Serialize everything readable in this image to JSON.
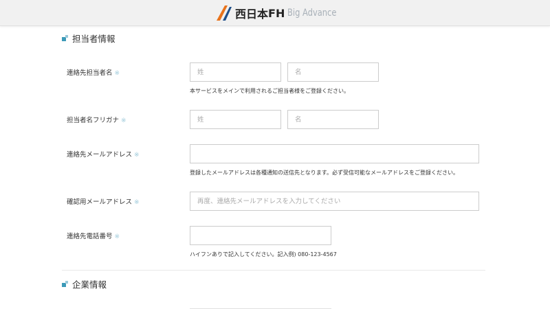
{
  "header": {
    "logo_jp": "西日本",
    "logo_fh": "FH",
    "logo_en": "Big Advance"
  },
  "section_contact": {
    "title": "担当者情報"
  },
  "section_company": {
    "title": "企業情報"
  },
  "required_mark": "※",
  "form": {
    "contact_name": {
      "label": "連絡先担当者名",
      "last_placeholder": "姓",
      "first_placeholder": "名",
      "help": "本サービスをメインで利用されるご担当者様をご登録ください。"
    },
    "contact_kana": {
      "label": "担当者名フリガナ",
      "last_placeholder": "姓",
      "first_placeholder": "名"
    },
    "email": {
      "label": "連絡先メールアドレス",
      "value": "",
      "help": "登録したメールアドレスは各種通知の送信先となります。必ず受信可能なメールアドレスをご登録ください。"
    },
    "email_confirm": {
      "label": "確認用メールアドレス",
      "placeholder": "再度、連絡先メールアドレスを入力してください"
    },
    "phone": {
      "label": "連絡先電話番号",
      "value": "",
      "help": "ハイフンありで記入してください。記入例) 080-123-4567"
    }
  }
}
